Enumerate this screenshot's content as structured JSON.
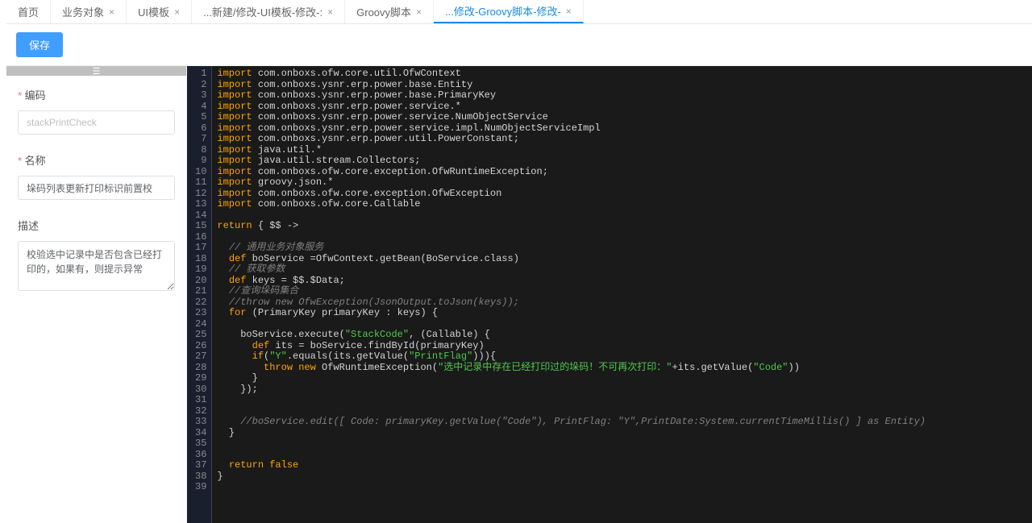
{
  "tabs": [
    {
      "label": "首页",
      "closable": false
    },
    {
      "label": "业务对象",
      "closable": true
    },
    {
      "label": "UI模板",
      "closable": true
    },
    {
      "label": "...新建/修改-UI模板-修改-:",
      "closable": true
    },
    {
      "label": "Groovy脚本",
      "closable": true
    },
    {
      "label": "...修改-Groovy脚本-修改-",
      "closable": true,
      "active": true
    }
  ],
  "toolbar": {
    "save_label": "保存"
  },
  "form": {
    "code_label": "编码",
    "code_placeholder": "stackPrintCheck",
    "code_value": "",
    "name_label": "名称",
    "name_value": "垛码列表更新打印标识前置校",
    "desc_label": "描述",
    "desc_value": "校验选中记录中是否包含已经打印的，如果有，则提示异常"
  },
  "editor": {
    "line_count": 39,
    "lines": [
      {
        "t": [
          [
            "kw",
            "import"
          ],
          [
            "sep",
            " "
          ],
          [
            "pkg",
            "com.onboxs.ofw.core.util.OfwContext"
          ]
        ]
      },
      {
        "t": [
          [
            "kw",
            "import"
          ],
          [
            "sep",
            " "
          ],
          [
            "pkg",
            "com.onboxs.ysnr.erp.power.base.Entity"
          ]
        ]
      },
      {
        "t": [
          [
            "kw",
            "import"
          ],
          [
            "sep",
            " "
          ],
          [
            "pkg",
            "com.onboxs.ysnr.erp.power.base.PrimaryKey"
          ]
        ]
      },
      {
        "t": [
          [
            "kw",
            "import"
          ],
          [
            "sep",
            " "
          ],
          [
            "pkg",
            "com.onboxs.ysnr.erp.power.service.*"
          ]
        ]
      },
      {
        "t": [
          [
            "kw",
            "import"
          ],
          [
            "sep",
            " "
          ],
          [
            "pkg",
            "com.onboxs.ysnr.erp.power.service.NumObjectService"
          ]
        ]
      },
      {
        "t": [
          [
            "kw",
            "import"
          ],
          [
            "sep",
            " "
          ],
          [
            "pkg",
            "com.onboxs.ysnr.erp.power.service.impl.NumObjectServiceImpl"
          ]
        ]
      },
      {
        "t": [
          [
            "kw",
            "import"
          ],
          [
            "sep",
            " "
          ],
          [
            "pkg",
            "com.onboxs.ysnr.erp.power.util.PowerConstant"
          ],
          [
            "sep",
            ";"
          ]
        ]
      },
      {
        "t": [
          [
            "kw",
            "import"
          ],
          [
            "sep",
            " "
          ],
          [
            "pkg",
            "java.util.*"
          ]
        ]
      },
      {
        "t": [
          [
            "kw",
            "import"
          ],
          [
            "sep",
            " "
          ],
          [
            "pkg",
            "java.util.stream.Collectors"
          ],
          [
            "sep",
            ";"
          ]
        ]
      },
      {
        "t": [
          [
            "kw",
            "import"
          ],
          [
            "sep",
            " "
          ],
          [
            "pkg",
            "com.onboxs.ofw.core.exception.OfwRuntimeException"
          ],
          [
            "sep",
            ";"
          ]
        ]
      },
      {
        "t": [
          [
            "kw",
            "import"
          ],
          [
            "sep",
            " "
          ],
          [
            "pkg",
            "groovy.json.*"
          ]
        ]
      },
      {
        "t": [
          [
            "kw",
            "import"
          ],
          [
            "sep",
            " "
          ],
          [
            "pkg",
            "com.onboxs.ofw.core.exception.OfwException"
          ]
        ]
      },
      {
        "t": [
          [
            "kw",
            "import"
          ],
          [
            "sep",
            " "
          ],
          [
            "pkg",
            "com.onboxs.ofw.core.Callable"
          ]
        ]
      },
      {
        "t": []
      },
      {
        "t": [
          [
            "kw",
            "return"
          ],
          [
            "sep",
            " { $$ ->"
          ]
        ]
      },
      {
        "t": []
      },
      {
        "t": [
          [
            "sep",
            "  "
          ],
          [
            "cmt",
            "// 通用业务对象服务"
          ]
        ]
      },
      {
        "t": [
          [
            "sep",
            "  "
          ],
          [
            "kw",
            "def"
          ],
          [
            "sep",
            " boService ="
          ],
          [
            "cls",
            "OfwContext"
          ],
          [
            "sep",
            ".getBean("
          ],
          [
            "cls",
            "BoService"
          ],
          [
            "sep",
            ".class)"
          ]
        ]
      },
      {
        "t": [
          [
            "sep",
            "  "
          ],
          [
            "cmt",
            "// 获取参数"
          ]
        ]
      },
      {
        "t": [
          [
            "sep",
            "  "
          ],
          [
            "kw",
            "def"
          ],
          [
            "sep",
            " keys = $$.$Data;"
          ]
        ]
      },
      {
        "t": [
          [
            "sep",
            "  "
          ],
          [
            "cmt",
            "//查询垛码集合"
          ]
        ]
      },
      {
        "t": [
          [
            "sep",
            "  "
          ],
          [
            "cmt",
            "//throw new OfwException(JsonOutput.toJson(keys));"
          ]
        ]
      },
      {
        "t": [
          [
            "sep",
            "  "
          ],
          [
            "kw",
            "for"
          ],
          [
            "sep",
            " ("
          ],
          [
            "cls",
            "PrimaryKey"
          ],
          [
            "sep",
            " primaryKey : keys) {"
          ]
        ]
      },
      {
        "t": []
      },
      {
        "t": [
          [
            "sep",
            "    boService.execute("
          ],
          [
            "str",
            "\"StackCode\""
          ],
          [
            "sep",
            ", ("
          ],
          [
            "cls",
            "Callable"
          ],
          [
            "sep",
            ") {"
          ]
        ]
      },
      {
        "t": [
          [
            "sep",
            "      "
          ],
          [
            "kw",
            "def"
          ],
          [
            "sep",
            " its = boService.findById(primaryKey)"
          ]
        ]
      },
      {
        "t": [
          [
            "sep",
            "      "
          ],
          [
            "kw",
            "if"
          ],
          [
            "sep",
            "("
          ],
          [
            "str",
            "\"Y\""
          ],
          [
            "sep",
            ".equals(its.getValue("
          ],
          [
            "str",
            "\"PrintFlag\""
          ],
          [
            "sep",
            "))){"
          ]
        ]
      },
      {
        "t": [
          [
            "sep",
            "        "
          ],
          [
            "kw",
            "throw new"
          ],
          [
            "sep",
            " "
          ],
          [
            "cls",
            "OfwRuntimeException"
          ],
          [
            "sep",
            "("
          ],
          [
            "str",
            "\"选中记录中存在已经打印过的垛码！不可再次打印：\""
          ],
          [
            "sep",
            "+its.getValue("
          ],
          [
            "str",
            "\"Code\""
          ],
          [
            "sep",
            "))"
          ]
        ]
      },
      {
        "t": [
          [
            "sep",
            "      }"
          ]
        ]
      },
      {
        "t": [
          [
            "sep",
            "    });"
          ]
        ]
      },
      {
        "t": []
      },
      {
        "t": []
      },
      {
        "t": [
          [
            "sep",
            "    "
          ],
          [
            "cmt",
            "//boService.edit([ Code: primaryKey.getValue(\"Code\"), PrintFlag: \"Y\",PrintDate:System.currentTimeMillis() ] as Entity)"
          ]
        ]
      },
      {
        "t": [
          [
            "sep",
            "  }"
          ]
        ]
      },
      {
        "t": []
      },
      {
        "t": []
      },
      {
        "t": [
          [
            "sep",
            "  "
          ],
          [
            "kw",
            "return"
          ],
          [
            "sep",
            " "
          ],
          [
            "bool",
            "false"
          ]
        ]
      },
      {
        "t": [
          [
            "sep",
            "}"
          ]
        ]
      }
    ]
  }
}
